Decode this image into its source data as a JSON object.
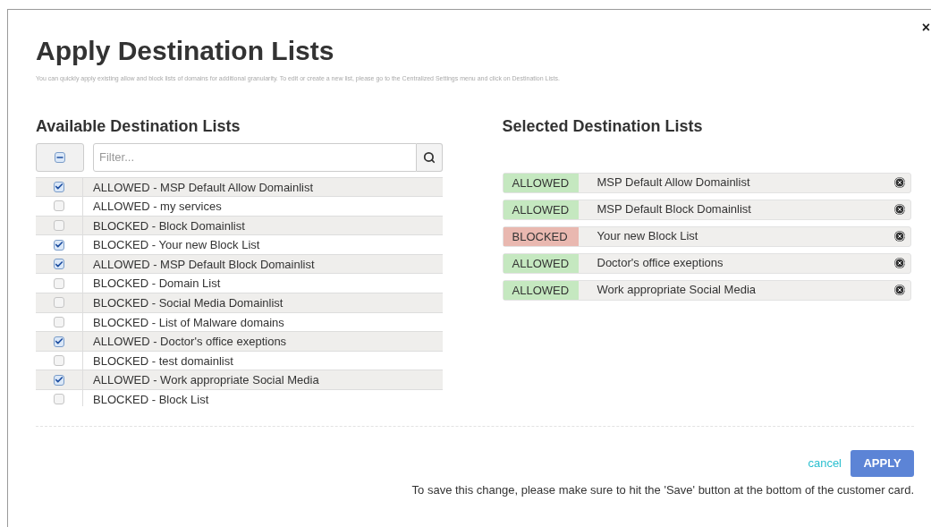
{
  "dialog": {
    "title": "Apply Destination Lists",
    "close": "×",
    "description": "You can quickly apply existing allow and block lists of domains for additional granularity. To edit or create a new list, please go to the Centralized Settings menu and click on Destination Lists."
  },
  "available": {
    "heading": "Available Destination Lists",
    "select_all": {
      "indeterminate": true
    },
    "filter": {
      "placeholder": "Filter..."
    },
    "rows": [
      {
        "label": "ALLOWED - MSP Default Allow Domainlist",
        "checked": true
      },
      {
        "label": "ALLOWED - my services",
        "checked": false
      },
      {
        "label": "BLOCKED - Block Domainlist",
        "checked": false
      },
      {
        "label": "BLOCKED - Your new Block List",
        "checked": true
      },
      {
        "label": "ALLOWED - MSP Default Block Domainlist",
        "checked": true
      },
      {
        "label": "BLOCKED - Domain List",
        "checked": false
      },
      {
        "label": "BLOCKED - Social Media Domainlist",
        "checked": false
      },
      {
        "label": "BLOCKED - List of Malware domains",
        "checked": false
      },
      {
        "label": "ALLOWED - Doctor's office exeptions",
        "checked": true
      },
      {
        "label": "BLOCKED - test domainlist",
        "checked": false
      },
      {
        "label": "ALLOWED - Work appropriate Social Media",
        "checked": true
      },
      {
        "label": "BLOCKED - Block List",
        "checked": false
      }
    ]
  },
  "selected": {
    "heading": "Selected Destination Lists",
    "items": [
      {
        "tag": "ALLOWED",
        "kind": "allowed",
        "name": "MSP Default Allow Domainlist"
      },
      {
        "tag": "ALLOWED",
        "kind": "allowed",
        "name": "MSP Default Block Domainlist"
      },
      {
        "tag": "BLOCKED",
        "kind": "blocked",
        "name": "Your new Block List"
      },
      {
        "tag": "ALLOWED",
        "kind": "allowed",
        "name": "Doctor's office exeptions"
      },
      {
        "tag": "ALLOWED",
        "kind": "allowed",
        "name": "Work appropriate Social Media"
      }
    ]
  },
  "footer": {
    "cancel": "cancel",
    "apply": "APPLY",
    "note": "To save this change, please make sure to hit the 'Save' button at the bottom of the customer card."
  }
}
